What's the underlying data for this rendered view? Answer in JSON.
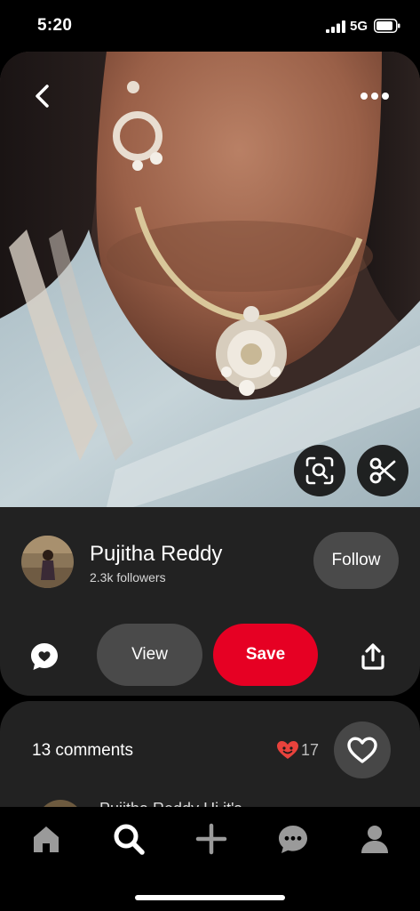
{
  "status_bar": {
    "time": "5:20",
    "network": "5G"
  },
  "pin": {
    "creator": {
      "name": "Pujitha Reddy",
      "followers": "2.3k followers"
    },
    "follow_label": "Follow",
    "view_label": "View",
    "save_label": "Save"
  },
  "comments": {
    "count_label": "13 comments",
    "reaction_count": "17",
    "preview_text": "Pujitha Reddy Hi it's"
  },
  "bottom_nav": {
    "items": [
      "home-icon",
      "search-icon",
      "create-icon",
      "messages-icon",
      "profile-icon"
    ],
    "active": "search"
  },
  "colors": {
    "save_red": "#e60023",
    "card_bg": "#222222",
    "secondary_button": "#4a4a4a",
    "reaction_red": "#e8423c"
  }
}
